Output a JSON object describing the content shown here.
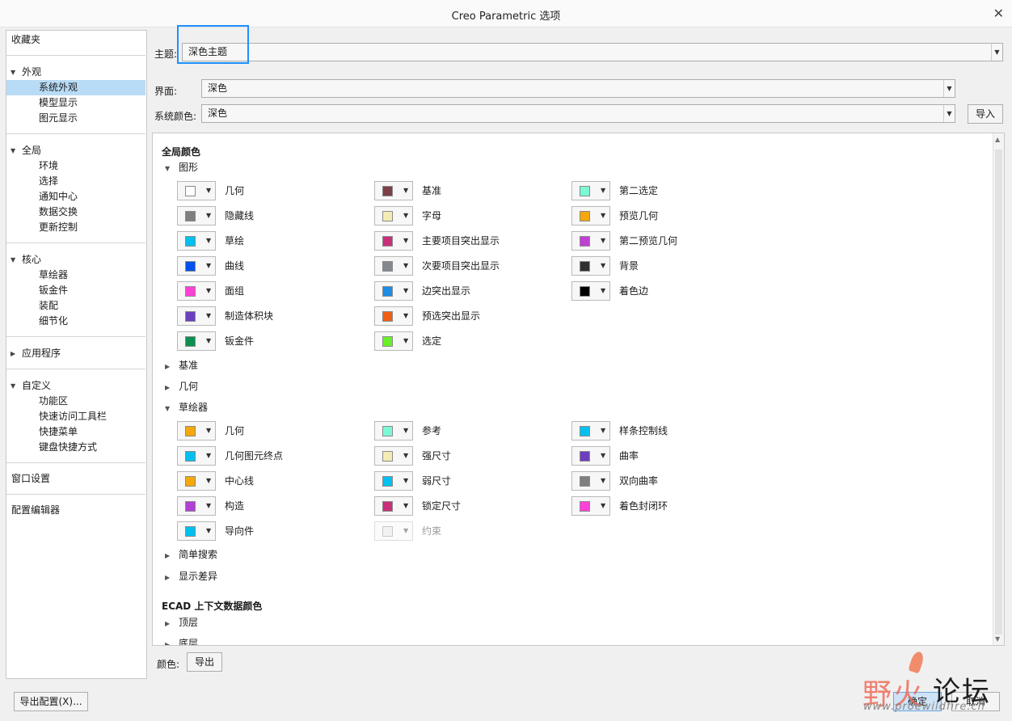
{
  "window": {
    "title": "Creo Parametric 选项",
    "close_glyph": "✕"
  },
  "nav": {
    "favorites": "收藏夹",
    "appearance": {
      "label": "外观",
      "items": [
        "系统外观",
        "模型显示",
        "图元显示"
      ]
    },
    "global": {
      "label": "全局",
      "items": [
        "环境",
        "选择",
        "通知中心",
        "数据交换",
        "更新控制"
      ]
    },
    "core": {
      "label": "核心",
      "items": [
        "草绘器",
        "钣金件",
        "装配",
        "细节化"
      ]
    },
    "applications": {
      "label": "应用程序"
    },
    "customize": {
      "label": "自定义",
      "items": [
        "功能区",
        "快速访问工具栏",
        "快捷菜单",
        "键盘快捷方式"
      ]
    },
    "window_settings": "窗口设置",
    "config_editor": "配置编辑器",
    "selected": "系统外观"
  },
  "top": {
    "theme_label": "主题:",
    "theme_value": "深色主题",
    "interface_label": "界面:",
    "interface_value": "深色",
    "syscolor_label": "系统颜色:",
    "syscolor_value": "深色",
    "import_button": "导入"
  },
  "global_colors": {
    "title": "全局颜色",
    "graphics": {
      "label": "图形",
      "items": [
        {
          "label": "几何",
          "color": "#ffffff"
        },
        {
          "label": "隐藏线",
          "color": "#7f7f7f"
        },
        {
          "label": "草绘",
          "color": "#00c0f0"
        },
        {
          "label": "曲线",
          "color": "#0050f0"
        },
        {
          "label": "面组",
          "color": "#ff40d8"
        },
        {
          "label": "制造体积块",
          "color": "#6b3fc0"
        },
        {
          "label": "钣金件",
          "color": "#0c8f50"
        },
        {
          "label": "基准",
          "color": "#7b4048"
        },
        {
          "label": "字母",
          "color": "#f4ecb4"
        },
        {
          "label": "主要项目突出显示",
          "color": "#c8307a"
        },
        {
          "label": "次要项目突出显示",
          "color": "#84888f"
        },
        {
          "label": "边突出显示",
          "color": "#1c8ee4"
        },
        {
          "label": "预选突出显示",
          "color": "#f06014"
        },
        {
          "label": "选定",
          "color": "#68f028"
        },
        {
          "label": "第二选定",
          "color": "#7cf8d4"
        },
        {
          "label": "预览几何",
          "color": "#f4a80c"
        },
        {
          "label": "第二预览几何",
          "color": "#c040d4"
        },
        {
          "label": "背景",
          "color": "#303030"
        },
        {
          "label": "着色边",
          "color": "#000000"
        }
      ]
    },
    "datum": "基准",
    "geometry": "几何",
    "sketcher": {
      "label": "草绘器",
      "items": [
        {
          "label": "几何",
          "color": "#f4a80c"
        },
        {
          "label": "几何图元终点",
          "color": "#00c0f0"
        },
        {
          "label": "中心线",
          "color": "#f4a80c"
        },
        {
          "label": "构造",
          "color": "#b040d4"
        },
        {
          "label": "导向件",
          "color": "#00c0f0"
        },
        {
          "label": "参考",
          "color": "#7cf8d4"
        },
        {
          "label": "强尺寸",
          "color": "#f4ecb4"
        },
        {
          "label": "弱尺寸",
          "color": "#00c0f0"
        },
        {
          "label": "锁定尺寸",
          "color": "#c8307a"
        },
        {
          "label": "约束",
          "color": "#e4e4e4",
          "disabled": true
        },
        {
          "label": "样条控制线",
          "color": "#00c0f0"
        },
        {
          "label": "曲率",
          "color": "#6b3fc0"
        },
        {
          "label": "双向曲率",
          "color": "#7f7f7f"
        },
        {
          "label": "着色封闭环",
          "color": "#ff40d8"
        }
      ]
    },
    "simple_search": "简单搜索",
    "display_diff": "显示差异"
  },
  "ecad": {
    "title": "ECAD 上下文数据颜色",
    "top_layer": "顶层",
    "bottom_layer": "底层"
  },
  "footer": {
    "color_label": "颜色:",
    "export_button": "导出",
    "export_config_button": "导出配置(X)...",
    "ok_button": "确定",
    "cancel_button": "取消"
  },
  "watermark": {
    "cn_a": "野火",
    "cn_b": "论坛",
    "url": "www.proewildfire.cn"
  }
}
